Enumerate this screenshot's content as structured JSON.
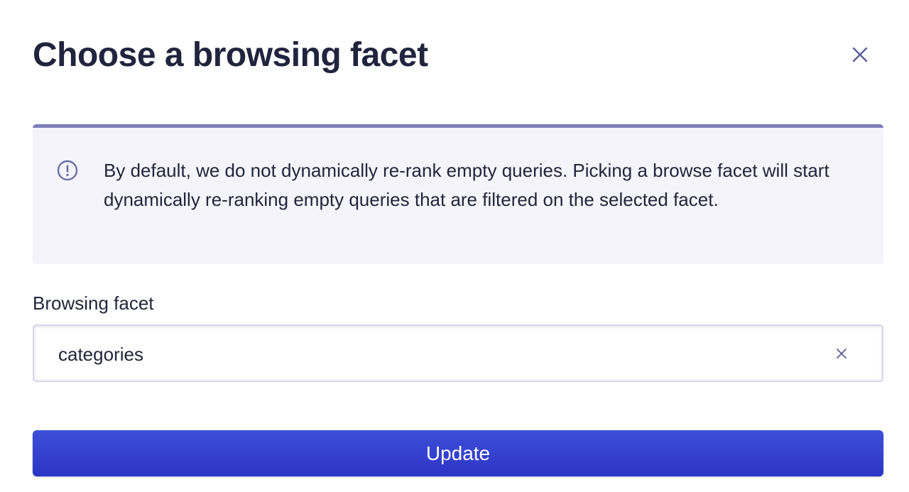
{
  "modal": {
    "title": "Choose a browsing facet",
    "close_icon": "close-icon"
  },
  "callout": {
    "icon": "info-circle-icon",
    "text": "By default, we do not dynamically re-rank empty queries. Picking a browse facet will start dynamically re-ranking empty queries that are filtered on the selected facet."
  },
  "field": {
    "label": "Browsing facet",
    "value": "categories",
    "clear_icon": "clear-icon"
  },
  "actions": {
    "update_label": "Update"
  },
  "colors": {
    "title_text": "#21243d",
    "callout_background": "#f4f4fa",
    "callout_border": "#7b7fb9",
    "primary_button": "#3a46d4",
    "icon_color": "#5a5e9a"
  }
}
